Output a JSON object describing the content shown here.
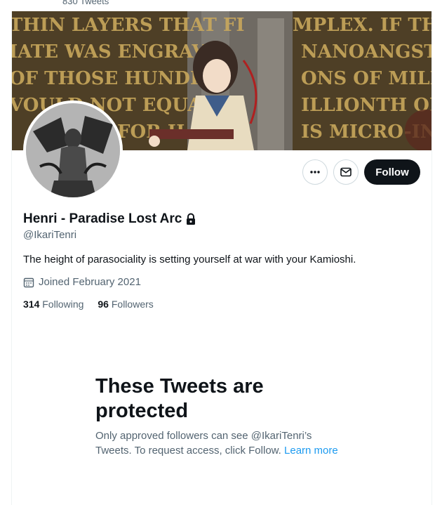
{
  "header": {
    "tweet_count": "830 Tweets"
  },
  "banner": {
    "alt": "",
    "text_lines": [
      "THIN LAYERS THAT FI",
      "IATE WAS ENGRAVE",
      "OF THOSE HUNDRE",
      "VOULD NOT EQUAL",
      "FOR H",
      "MPLEX. IF THE W",
      "NANOANGSTRO",
      "ONS OF MILES H",
      "ILLIONTH OF TH",
      "IS MICRO-INST"
    ]
  },
  "profile": {
    "display_name": "Henri - Paradise Lost Arc",
    "handle": "@IkariTenri",
    "bio": "The height of parasociality is setting yourself at war with your Kamioshi.",
    "joined": "Joined February 2021",
    "following_count": "314",
    "following_label": "Following",
    "followers_count": "96",
    "followers_label": "Followers",
    "locked": true
  },
  "actions": {
    "more_icon": "more-icon",
    "message_icon": "envelope-icon",
    "follow_label": "Follow"
  },
  "protected": {
    "title": "These Tweets are protected",
    "message": "Only approved followers can see @IkariTenri’s Tweets. To request access, click Follow.",
    "learn_more": "Learn more"
  },
  "colors": {
    "text_primary": "#0f1419",
    "text_secondary": "#536471",
    "link": "#1d9bf0",
    "follow_bg": "#0f1419",
    "border": "#cfd9de"
  }
}
